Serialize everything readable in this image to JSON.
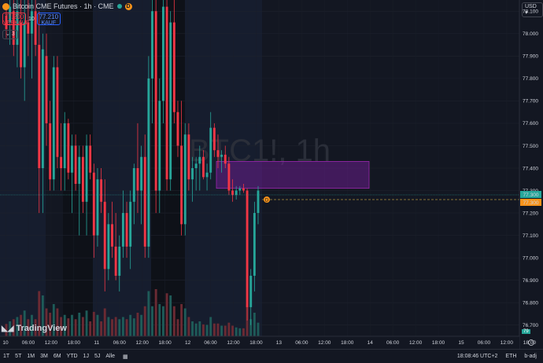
{
  "header": {
    "symbol_title": "Bitcoin CME Futures · 1h · CME",
    "sell_price": "77.200",
    "sell_label": "VERKAUF",
    "spread": "10",
    "buy_price": "77.210",
    "buy_label": "KAUF",
    "collapse_label": "3",
    "currency": "USD"
  },
  "watermark": "BTC1!, 1h",
  "logo_text": "TradingView",
  "price_axis": {
    "ticks": [
      "78.100",
      "78.000",
      "77.900",
      "77.800",
      "77.700",
      "77.600",
      "77.500",
      "77.400",
      "77.300",
      "77.200",
      "77.100",
      "77.000",
      "76.900",
      "76.800",
      "76.700"
    ],
    "current_price": "77.300",
    "last_price": "77.300",
    "volume_badge": "79"
  },
  "time_axis": {
    "ticks": [
      "10",
      "06:00",
      "12:00",
      "18:00",
      "11",
      "06:00",
      "12:00",
      "18:00",
      "12",
      "06:00",
      "12:00",
      "18:00",
      "13",
      "06:00",
      "12:00",
      "18:00",
      "14",
      "06:00",
      "12:00",
      "18:00",
      "15",
      "06:00",
      "12:00",
      "18:00",
      "16",
      "06:00",
      "12:00"
    ]
  },
  "bottom_bar": {
    "ranges": [
      "1T",
      "5T",
      "1M",
      "3M",
      "6M",
      "YTD",
      "1J",
      "5J",
      "Alle"
    ],
    "time": "18:08:46 UTC+2",
    "session": "ETH",
    "adjust": "b-adj"
  },
  "chart_data": {
    "type": "candlestick",
    "ylim": [
      76.65,
      78.15
    ],
    "up_color": "#26a69a",
    "down_color": "#f23645",
    "candles": [
      {
        "o": 78.08,
        "h": 78.12,
        "l": 77.98,
        "c": 78.02
      },
      {
        "o": 78.05,
        "h": 78.15,
        "l": 77.95,
        "c": 78.12
      },
      {
        "o": 78.1,
        "h": 78.15,
        "l": 77.9,
        "c": 77.95
      },
      {
        "o": 77.95,
        "h": 78.15,
        "l": 77.85,
        "c": 78.1
      },
      {
        "o": 78.05,
        "h": 78.15,
        "l": 77.8,
        "c": 77.85
      },
      {
        "o": 77.85,
        "h": 78.15,
        "l": 77.7,
        "c": 78.05
      },
      {
        "o": 78.05,
        "h": 78.15,
        "l": 77.9,
        "c": 78.0
      },
      {
        "o": 78.0,
        "h": 78.15,
        "l": 77.8,
        "c": 78.1
      },
      {
        "o": 78.1,
        "h": 78.15,
        "l": 77.9,
        "c": 77.95
      },
      {
        "o": 77.95,
        "h": 78.1,
        "l": 77.2,
        "c": 77.4
      },
      {
        "o": 77.4,
        "h": 78.0,
        "l": 77.2,
        "c": 77.93
      },
      {
        "o": 77.9,
        "h": 78.0,
        "l": 77.5,
        "c": 77.6
      },
      {
        "o": 77.6,
        "h": 77.7,
        "l": 77.3,
        "c": 77.35
      },
      {
        "o": 77.35,
        "h": 77.9,
        "l": 77.3,
        "c": 77.85
      },
      {
        "o": 77.85,
        "h": 77.9,
        "l": 77.4,
        "c": 77.45
      },
      {
        "o": 77.45,
        "h": 77.6,
        "l": 77.3,
        "c": 77.4
      },
      {
        "o": 77.4,
        "h": 77.65,
        "l": 77.3,
        "c": 77.6
      },
      {
        "o": 77.6,
        "h": 77.62,
        "l": 77.35,
        "c": 77.38
      },
      {
        "o": 77.38,
        "h": 77.55,
        "l": 77.2,
        "c": 77.5
      },
      {
        "o": 77.5,
        "h": 77.55,
        "l": 77.3,
        "c": 77.33
      },
      {
        "o": 77.33,
        "h": 77.5,
        "l": 77.1,
        "c": 77.45
      },
      {
        "o": 77.45,
        "h": 77.5,
        "l": 77.2,
        "c": 77.25
      },
      {
        "o": 77.25,
        "h": 77.55,
        "l": 77.1,
        "c": 77.5
      },
      {
        "o": 77.5,
        "h": 77.55,
        "l": 77.35,
        "c": 77.38
      },
      {
        "o": 77.38,
        "h": 77.42,
        "l": 77.0,
        "c": 77.1
      },
      {
        "o": 77.1,
        "h": 77.4,
        "l": 77.05,
        "c": 77.35
      },
      {
        "o": 77.35,
        "h": 77.4,
        "l": 77.2,
        "c": 77.25
      },
      {
        "o": 77.25,
        "h": 77.35,
        "l": 76.85,
        "c": 76.95
      },
      {
        "o": 76.95,
        "h": 77.2,
        "l": 76.9,
        "c": 77.15
      },
      {
        "o": 77.15,
        "h": 77.25,
        "l": 77.0,
        "c": 77.05
      },
      {
        "o": 77.05,
        "h": 77.2,
        "l": 76.9,
        "c": 76.92
      },
      {
        "o": 76.92,
        "h": 77.1,
        "l": 76.85,
        "c": 77.05
      },
      {
        "o": 77.05,
        "h": 77.3,
        "l": 77.0,
        "c": 77.2
      },
      {
        "o": 77.2,
        "h": 77.25,
        "l": 77.0,
        "c": 77.05
      },
      {
        "o": 77.05,
        "h": 77.3,
        "l": 76.95,
        "c": 77.25
      },
      {
        "o": 77.25,
        "h": 77.42,
        "l": 77.15,
        "c": 77.4
      },
      {
        "o": 77.4,
        "h": 77.6,
        "l": 77.2,
        "c": 77.3
      },
      {
        "o": 77.3,
        "h": 77.5,
        "l": 77.15,
        "c": 77.45
      },
      {
        "o": 77.45,
        "h": 77.55,
        "l": 77.0,
        "c": 77.05
      },
      {
        "o": 77.05,
        "h": 77.9,
        "l": 77.0,
        "c": 77.8
      },
      {
        "o": 77.8,
        "h": 78.15,
        "l": 77.6,
        "c": 78.1
      },
      {
        "o": 78.1,
        "h": 78.15,
        "l": 77.2,
        "c": 77.3
      },
      {
        "o": 77.3,
        "h": 77.8,
        "l": 77.2,
        "c": 77.7
      },
      {
        "o": 77.7,
        "h": 78.15,
        "l": 77.6,
        "c": 78.12
      },
      {
        "o": 78.12,
        "h": 78.15,
        "l": 77.3,
        "c": 77.35
      },
      {
        "o": 77.35,
        "h": 78.1,
        "l": 77.3,
        "c": 78.05
      },
      {
        "o": 78.05,
        "h": 78.15,
        "l": 77.6,
        "c": 77.65
      },
      {
        "o": 77.65,
        "h": 77.7,
        "l": 77.45,
        "c": 77.5
      },
      {
        "o": 77.5,
        "h": 77.7,
        "l": 77.1,
        "c": 77.15
      },
      {
        "o": 77.15,
        "h": 77.6,
        "l": 77.1,
        "c": 77.55
      },
      {
        "o": 77.55,
        "h": 77.6,
        "l": 77.3,
        "c": 77.35
      },
      {
        "o": 77.35,
        "h": 77.45,
        "l": 77.25,
        "c": 77.4
      },
      {
        "o": 77.4,
        "h": 77.45,
        "l": 77.3,
        "c": 77.42
      },
      {
        "o": 77.42,
        "h": 77.5,
        "l": 77.3,
        "c": 77.45
      },
      {
        "o": 77.45,
        "h": 77.48,
        "l": 77.35,
        "c": 77.36
      },
      {
        "o": 77.36,
        "h": 77.42,
        "l": 77.3,
        "c": 77.38
      },
      {
        "o": 77.38,
        "h": 77.65,
        "l": 77.35,
        "c": 77.58
      },
      {
        "o": 77.58,
        "h": 77.6,
        "l": 77.45,
        "c": 77.48
      },
      {
        "o": 77.48,
        "h": 77.55,
        "l": 77.4,
        "c": 77.45
      },
      {
        "o": 77.45,
        "h": 77.48,
        "l": 77.38,
        "c": 77.46
      },
      {
        "o": 77.46,
        "h": 77.5,
        "l": 77.4,
        "c": 77.42
      },
      {
        "o": 77.42,
        "h": 77.45,
        "l": 77.28,
        "c": 77.3
      },
      {
        "o": 77.3,
        "h": 77.35,
        "l": 77.25,
        "c": 77.28
      },
      {
        "o": 77.28,
        "h": 77.32,
        "l": 77.26,
        "c": 77.3
      },
      {
        "o": 77.3,
        "h": 77.32,
        "l": 77.28,
        "c": 77.31
      },
      {
        "o": 77.31,
        "h": 77.33,
        "l": 77.29,
        "c": 77.3
      },
      {
        "o": 77.3,
        "h": 77.31,
        "l": 76.72,
        "c": 76.78
      },
      {
        "o": 76.78,
        "h": 76.95,
        "l": 76.7,
        "c": 76.92
      },
      {
        "o": 76.92,
        "h": 77.25,
        "l": 76.85,
        "c": 77.2
      },
      {
        "o": 77.2,
        "h": 77.32,
        "l": 77.15,
        "c": 77.3
      }
    ],
    "zone": {
      "price_top": 77.43,
      "price_bottom": 77.31
    }
  }
}
